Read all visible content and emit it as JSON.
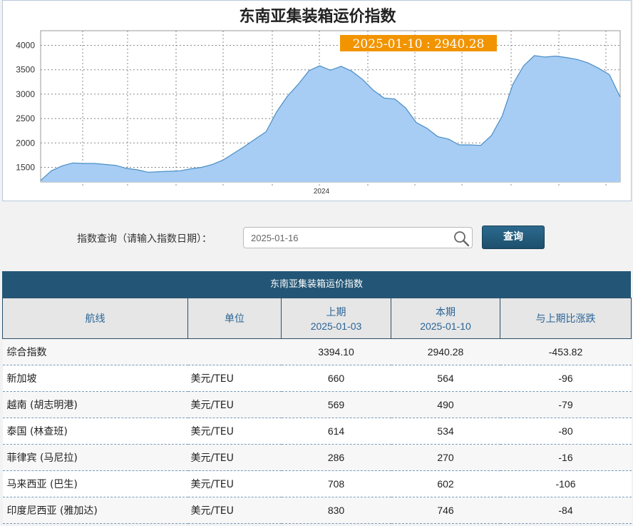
{
  "chart": {
    "title": "东南亚集装箱运价指数",
    "tooltip": "2025-01-10 : 2940.28",
    "y_ticks": [
      "4000",
      "3500",
      "3000",
      "2500",
      "2000",
      "1500"
    ],
    "x_label": "2024"
  },
  "chart_data": {
    "type": "area",
    "title": "东南亚集装箱运价指数",
    "ylim": [
      1200,
      4300
    ],
    "y_ticks": [
      1500,
      2000,
      2500,
      3000,
      3500,
      4000
    ],
    "x_tick_label": "2024",
    "grid": true,
    "color": "#a7cdf5",
    "line_color": "#4a8ec4",
    "values": [
      1230,
      1430,
      1530,
      1590,
      1580,
      1580,
      1560,
      1540,
      1480,
      1450,
      1400,
      1410,
      1420,
      1430,
      1470,
      1500,
      1560,
      1650,
      1790,
      1930,
      2080,
      2230,
      2640,
      2960,
      3200,
      3480,
      3580,
      3490,
      3570,
      3470,
      3300,
      3080,
      2920,
      2900,
      2720,
      2420,
      2300,
      2130,
      2080,
      1960,
      1960,
      1950,
      2150,
      2550,
      3200,
      3580,
      3790,
      3760,
      3780,
      3750,
      3710,
      3640,
      3530,
      3400,
      2940
    ],
    "highlight": {
      "date": "2025-01-10",
      "value": 2940.28
    }
  },
  "query": {
    "label": "指数查询（请输入指数日期）：",
    "date_value": "2025-01-16",
    "button": "查询"
  },
  "table": {
    "caption": "东南亚集装箱运价指数",
    "headers": {
      "route": "航线",
      "unit": "单位",
      "prev_label": "上期",
      "prev_date": "2025-01-03",
      "curr_label": "本期",
      "curr_date": "2025-01-10",
      "change": "与上期比涨跌"
    },
    "rows": [
      {
        "route": "综合指数",
        "unit": "",
        "prev": "3394.10",
        "curr": "2940.28",
        "change": "-453.82"
      },
      {
        "route": "新加坡",
        "unit": "美元/TEU",
        "prev": "660",
        "curr": "564",
        "change": "-96"
      },
      {
        "route": "越南 (胡志明港)",
        "unit": "美元/TEU",
        "prev": "569",
        "curr": "490",
        "change": "-79"
      },
      {
        "route": "泰国 (林查班)",
        "unit": "美元/TEU",
        "prev": "614",
        "curr": "534",
        "change": "-80"
      },
      {
        "route": "菲律宾 (马尼拉)",
        "unit": "美元/TEU",
        "prev": "286",
        "curr": "270",
        "change": "-16"
      },
      {
        "route": "马来西亚 (巴生)",
        "unit": "美元/TEU",
        "prev": "708",
        "curr": "602",
        "change": "-106"
      },
      {
        "route": "印度尼西亚 (雅加达)",
        "unit": "美元/TEU",
        "prev": "830",
        "curr": "746",
        "change": "-84"
      }
    ]
  }
}
